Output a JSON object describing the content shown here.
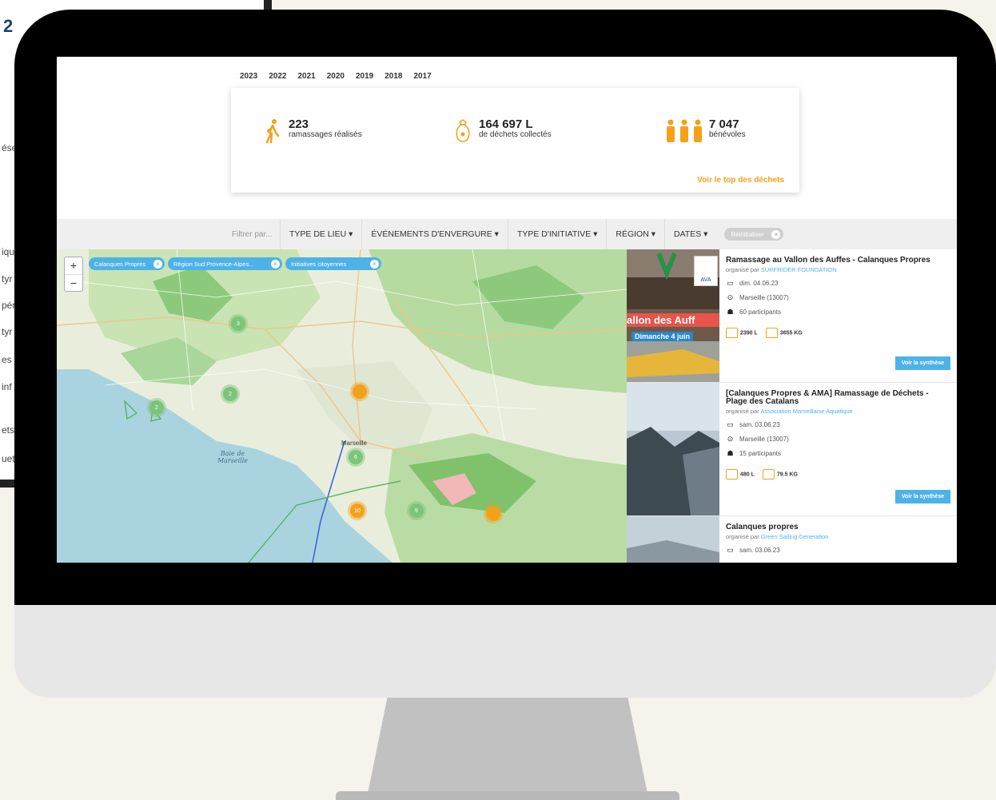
{
  "background_window": {
    "number_fragment": "2",
    "text_fragments": [
      "ése",
      "iqu",
      "tyr",
      "pér",
      "tyr",
      "es e",
      "inf",
      "ets",
      "uet"
    ]
  },
  "app": {
    "years": [
      "2023",
      "2022",
      "2021",
      "2020",
      "2019",
      "2018",
      "2017"
    ],
    "stats": [
      {
        "icon": "walking-person-icon",
        "value": "223",
        "label": "ramassages réalisés"
      },
      {
        "icon": "trash-bag-icon",
        "value": "164 697 L",
        "label": "de déchets collectés"
      },
      {
        "icon": "people-group-icon",
        "value": "7 047",
        "label": "bénévoles"
      }
    ],
    "top_link": "Voir le top des déchets",
    "filter": {
      "placeholder": "Filtrer par...",
      "items": [
        "TYPE DE LIEU ▾",
        "ÉVÉNEMENTS D'ENVERGURE ▾",
        "TYPE D'INITIATIVE ▾",
        "RÉGION ▾",
        "DATES ▾"
      ],
      "chip": "Réinitialiser"
    },
    "map": {
      "zoom_in": "+",
      "zoom_out": "−",
      "chips": [
        "Calanques Propres",
        "Région Sud Provence-Alpes...",
        "Initiatives citoyennes"
      ],
      "clusters": [
        {
          "label": "3",
          "color": "g"
        },
        {
          "label": "2",
          "color": "g"
        },
        {
          "label": "2",
          "color": "g"
        },
        {
          "label": "",
          "color": "o"
        },
        {
          "label": "6",
          "color": "g"
        },
        {
          "label": "10",
          "color": "o"
        },
        {
          "label": "9",
          "color": "g"
        },
        {
          "label": "",
          "color": "o"
        }
      ],
      "labels": {
        "bay": "Baie de Marseille",
        "city": "Marseille"
      }
    },
    "events": [
      {
        "title": "Ramassage au Vallon des Auffes - Calanques Propres",
        "org_prefix": "organisé par",
        "org": "SURFRIDER FOUNDATION",
        "date": "dim. 04.06.23",
        "place": "Marseille (13007)",
        "participants": "60 participants",
        "liters": "2390 L",
        "kilos": "3655 KG",
        "button": "Voir la synthèse",
        "image_text_1": "allon des Auff",
        "image_text_2": "Dimanche 4 juin",
        "badge": "AVA"
      },
      {
        "title": "[Calanques Propres & AMA] Ramassage de Déchets - Plage des Catalans",
        "org_prefix": "organisé par",
        "org": "Association Marseillaise Aquatique",
        "date": "sam. 03.06.23",
        "place": "Marseille (13007)",
        "participants": "15 participants",
        "liters": "480 L",
        "kilos": "79.5 KG",
        "button": "Voir la synthèse"
      },
      {
        "title": "Calanques propres",
        "org_prefix": "organisé par",
        "org": "Green Sailing Generation",
        "date": "sam. 03.06.23"
      }
    ],
    "colors": {
      "accent_orange": "#f4a11a",
      "accent_blue": "#4db2e8",
      "bezel": "#000000"
    }
  }
}
